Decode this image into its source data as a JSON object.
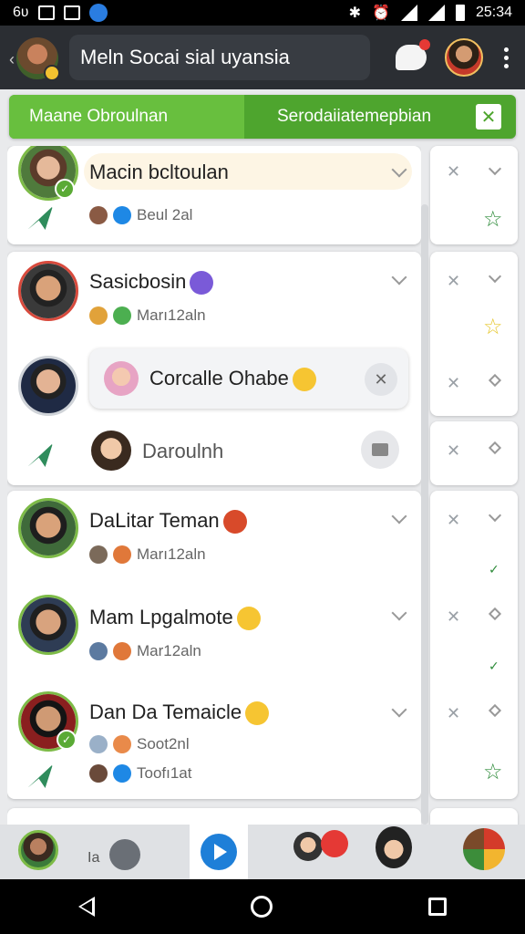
{
  "status_bar": {
    "left_text": "6ʋ",
    "time": "25:34"
  },
  "app_bar": {
    "title": "Meln Socai sial uyansia"
  },
  "tabs": [
    {
      "label": "Maane Obroulnan",
      "active": true
    },
    {
      "label": "Serodaiiatemepbian",
      "active": false
    }
  ],
  "chats": [
    {
      "name": "Macin bcltoulan",
      "sub": "Beul 2al"
    },
    {
      "name": "Sasicbosin",
      "sub": "Marı12aln"
    },
    {
      "search_label": "Corcalle Ohabe"
    },
    {
      "name": "Daroulnh"
    },
    {
      "name": "DaLitar Teman",
      "sub": "Marı12aln"
    },
    {
      "name": "Mam Lpgalmote",
      "sub": "Mar12aln"
    },
    {
      "name": "Dan Da Temaicle",
      "sub": "Soot2nl",
      "sub2": "Toofı1at"
    }
  ],
  "bottom_bar": {
    "label": "Ia"
  },
  "colors": {
    "accent_green": "#4ea52e",
    "active_tab": "#68bf3e",
    "appbar": "#2b2e33"
  }
}
